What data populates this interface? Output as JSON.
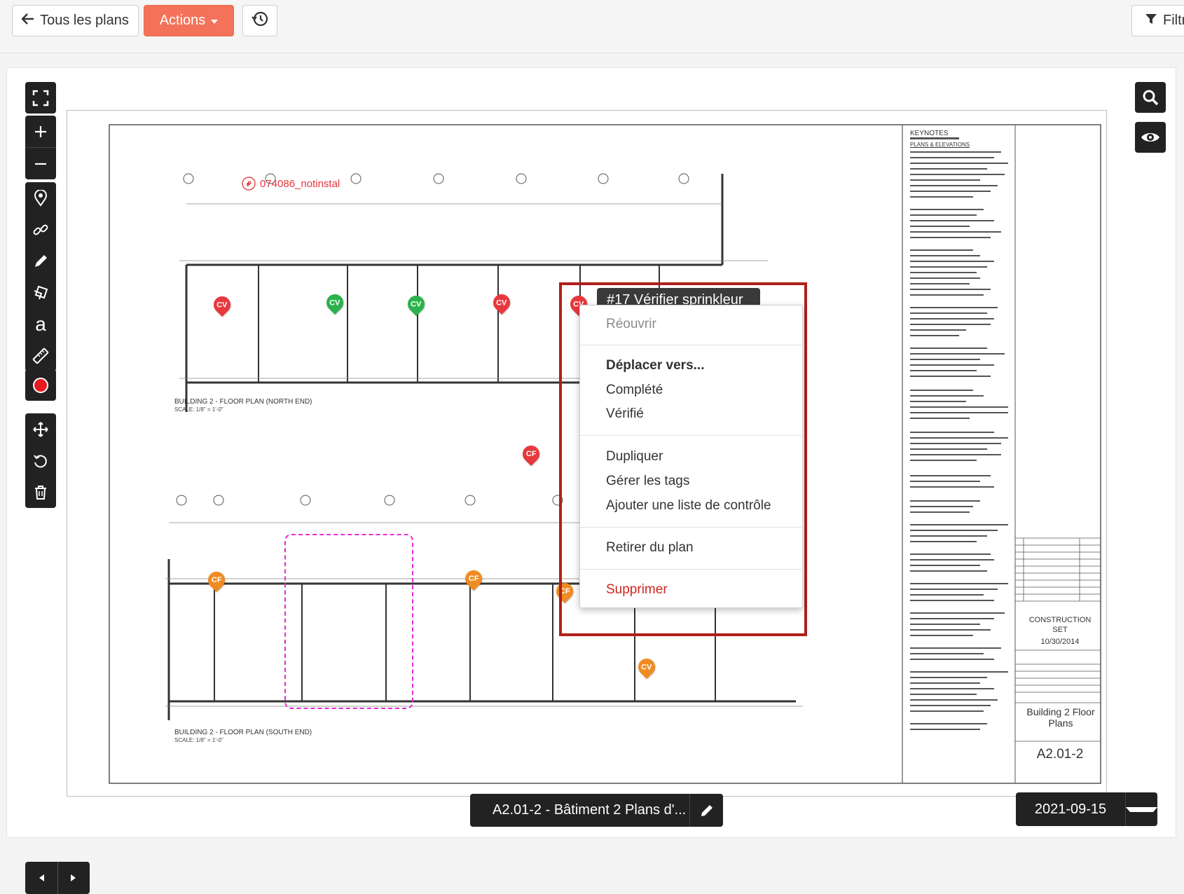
{
  "toolbar": {
    "back_label": "Tous les plans",
    "actions_label": "Actions",
    "filter_label": "Filtr"
  },
  "plan": {
    "name": "A2.01-2 - Bâtiment 2 Plans d'...",
    "date": "2021-09-15",
    "markup_label": "074086_notinstal"
  },
  "drawing": {
    "north_title": "BUILDING 2 - FLOOR PLAN (NORTH END)",
    "south_title": "BUILDING 2 - FLOOR PLAN (SOUTH END)",
    "scale_text": "SCALE: 1/8\" = 1'-0\"",
    "keynotes_title": "KEYNOTES",
    "plans_elevations": "PLANS & ELEVATIONS",
    "construction_set": "CONSTRUCTION SET",
    "set_date": "10/30/2014",
    "sheet_title": "Building 2 Floor Plans",
    "sheet_number": "A2.01-2"
  },
  "pins": [
    {
      "code": "CV",
      "color": "red"
    },
    {
      "code": "CV",
      "color": "green"
    },
    {
      "code": "CV",
      "color": "green"
    },
    {
      "code": "CV",
      "color": "red"
    },
    {
      "code": "CV",
      "color": "red"
    },
    {
      "code": "CF",
      "color": "red"
    },
    {
      "code": "CF",
      "color": "orange"
    },
    {
      "code": "CF",
      "color": "orange"
    },
    {
      "code": "CF",
      "color": "orange"
    },
    {
      "code": "CV",
      "color": "orange"
    }
  ],
  "tooltip": "#17 Vérifier sprinkleur",
  "context_menu": {
    "reopen": "Réouvrir",
    "move_to": "Déplacer vers...",
    "completed": "Complété",
    "verified": "Vérifié",
    "duplicate": "Dupliquer",
    "manage_tags": "Gérer les tags",
    "add_checklist": "Ajouter une liste de contrôle",
    "remove_from_plan": "Retirer du plan",
    "delete": "Supprimer"
  },
  "colors": {
    "accent": "#f37259",
    "highlight": "#b01f1a",
    "danger": "#d0251f",
    "cloud": "#e82ad6"
  }
}
